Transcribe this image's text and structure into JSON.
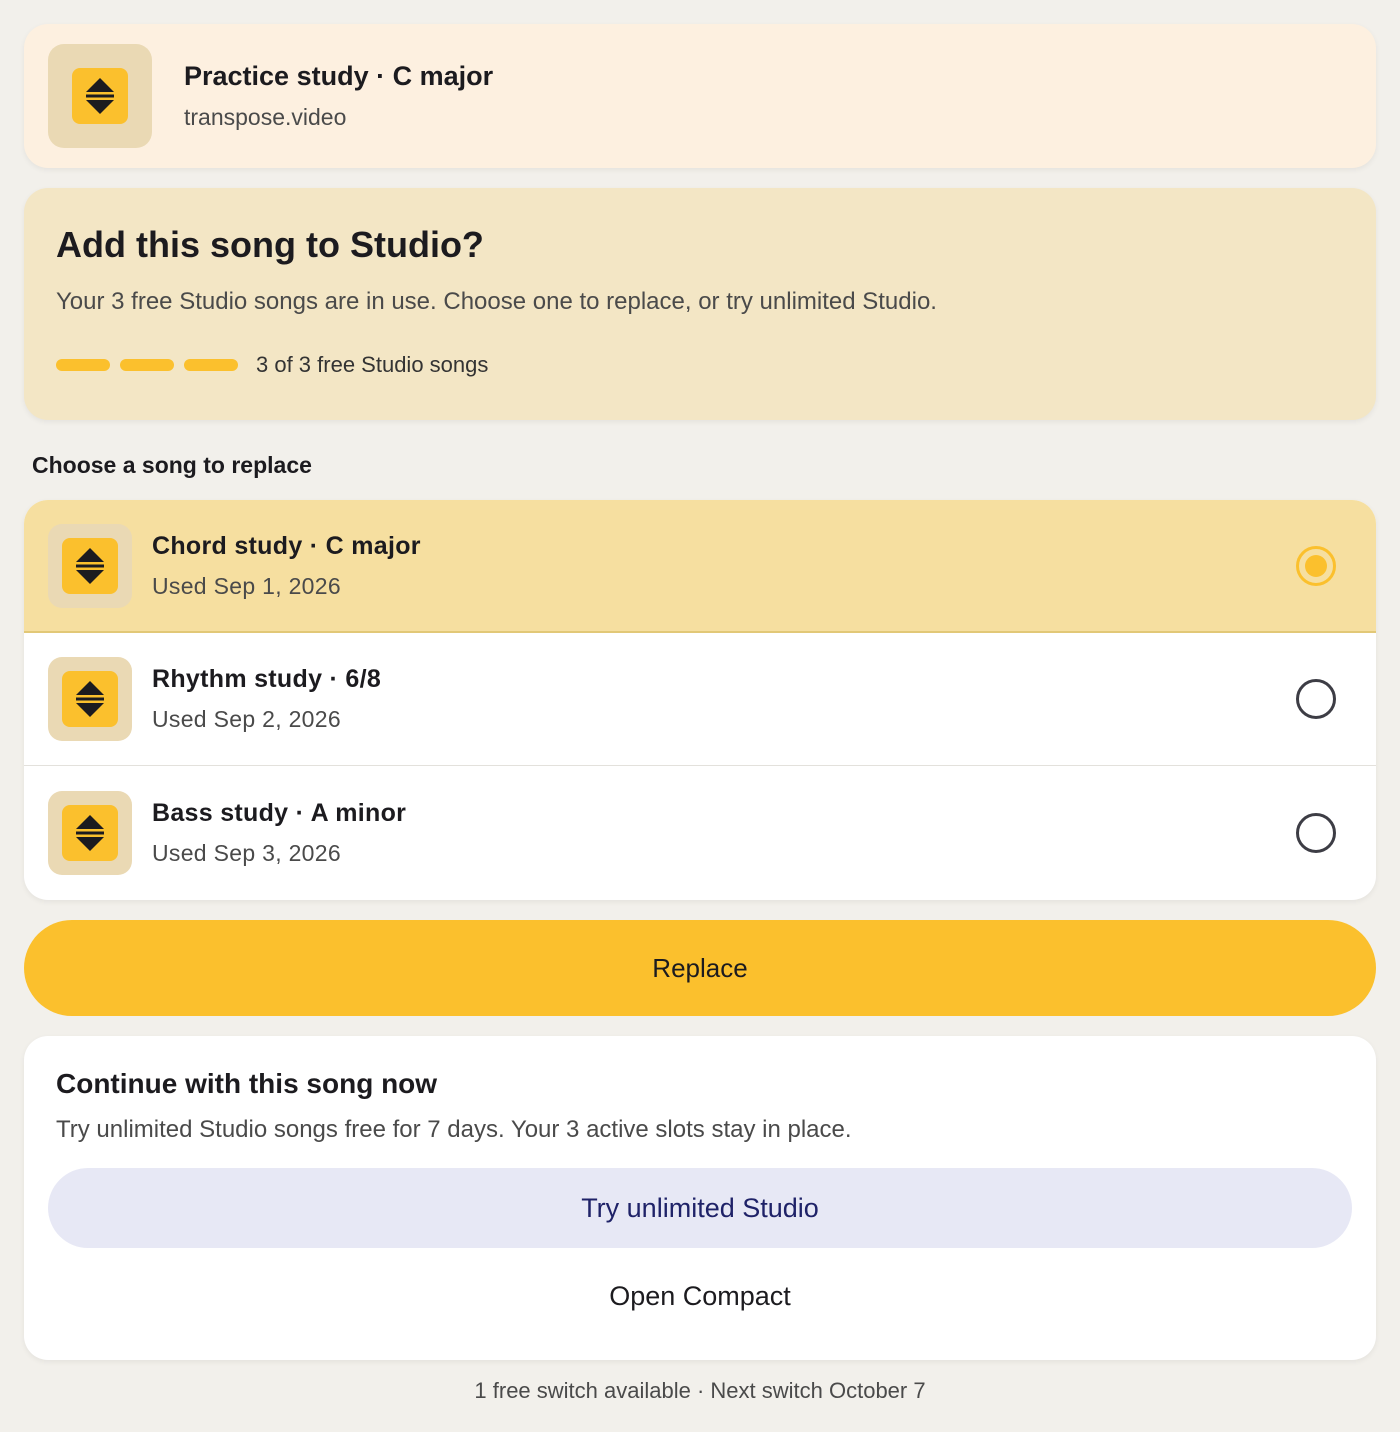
{
  "current_song": {
    "title": "Practice study · C major",
    "source": "transpose.video",
    "icon": "transpose-icon"
  },
  "prompt": {
    "title": "Add this song to Studio?",
    "description": "Your 3 free Studio songs are in use. Choose one to replace, or try unlimited Studio.",
    "usage_used": 3,
    "usage_total": 3,
    "usage_label": "3 of 3 free Studio songs"
  },
  "list": {
    "label": "Choose a song to replace",
    "items": [
      {
        "title": "Chord study · C major",
        "used": "Used Sep 1, 2026",
        "selected": true,
        "icon": "transpose-icon"
      },
      {
        "title": "Rhythm study · 6/8",
        "used": "Used Sep 2, 2026",
        "selected": false,
        "icon": "transpose-icon"
      },
      {
        "title": "Bass study · A minor",
        "used": "Used Sep 3, 2026",
        "selected": false,
        "icon": "transpose-icon"
      }
    ]
  },
  "actions": {
    "replace_label": "Replace"
  },
  "continue": {
    "title": "Continue with this song now",
    "description": "Try unlimited Studio songs free for 7 days. Your 3 active slots stay in place.",
    "try_label": "Try unlimited Studio",
    "compact_label": "Open Compact"
  },
  "footer": {
    "note": "1 free switch available · Next switch October 7"
  },
  "colors": {
    "accent": "#fbc02d",
    "selected_row": "#f6dfa0",
    "prompt_bg": "#f3e6c5",
    "header_bg": "#fdf0e0",
    "try_bg": "#e7e8f5",
    "try_text": "#1f2268"
  }
}
